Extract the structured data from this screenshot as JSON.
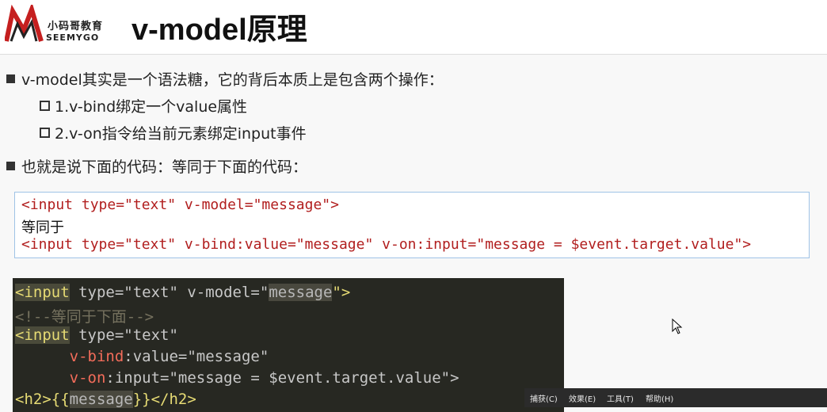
{
  "header": {
    "logo_cn": "小码哥教育",
    "logo_en": "SEEMYGO",
    "title": "v-model原理"
  },
  "bullets": {
    "b1": "v-model其实是一个语法糖，它的背后本质上是包含两个操作：",
    "b1_sub1": "1.v-bind绑定一个value属性",
    "b1_sub2": "2.v-on指令给当前元素绑定input事件",
    "b2": "也就是说下面的代码：等同于下面的代码："
  },
  "code_light": {
    "line1": "<input type=\"text\" v-model=\"message\">",
    "line2": "等同于",
    "line3": "<input type=\"text\" v-bind:value=\"message\" v-on:input=\"message = $event.target.value\">"
  },
  "code_dark": {
    "l1_lt": "<",
    "l1_tag": "input",
    "l1_attrs": " type=\"text\" v-model=\"",
    "l1_hl": "message",
    "l1_end": "\">",
    "l2_comment": "<!--等同于下面-->",
    "l3_lt": "<",
    "l3_tag": "input",
    "l3_attrs": " type=\"text\"",
    "l4_indent": "      ",
    "l4_dir": "v-bind",
    "l4_rest": ":value=\"message\"",
    "l5_indent": "      ",
    "l5_dir": "v-on",
    "l5_rest": ":input=\"message = $event.target.value\">",
    "l6_open": "<h2>{{",
    "l6_hl": "message",
    "l6_close": "}}</h2>"
  },
  "menubar": {
    "capture": "捕获(C)",
    "effects": "效果(E)",
    "tools": "工具(T)",
    "help": "帮助(H)"
  },
  "colors": {
    "accent_red": "#b11e1e",
    "editor_bg": "#272822",
    "editor_border_blue": "#9fc3e6"
  }
}
